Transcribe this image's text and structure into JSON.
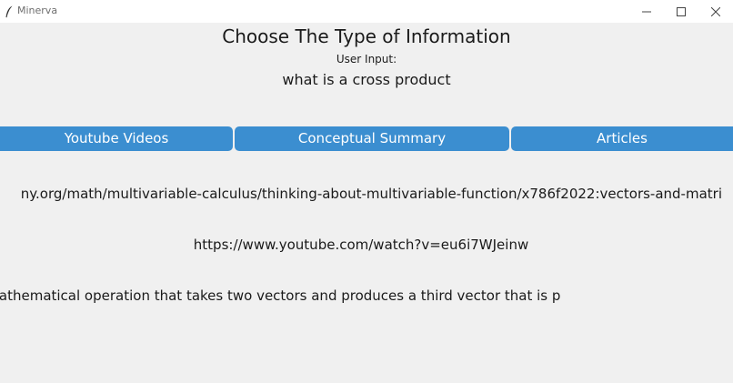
{
  "window": {
    "title": "Minerva"
  },
  "header": {
    "heading": "Choose The Type of Information",
    "input_label": "User Input:",
    "query": "what is a cross product"
  },
  "tabs": [
    {
      "label": "Youtube Videos"
    },
    {
      "label": "Conceptual Summary"
    },
    {
      "label": "Articles"
    }
  ],
  "results": {
    "line_1": "ny.org/math/multivariable-calculus/thinking-about-multivariable-function/x786f2022:vectors-and-matri",
    "line_2": "https://www.youtube.com/watch?v=eu6i7WJeinw",
    "line_3": "e vector product, is a mathematical operation that takes two vectors and produces a third vector that is p"
  },
  "colors": {
    "button_blue": "#3b8ed0",
    "background": "#f0f0f0",
    "titlebar": "#ffffff"
  }
}
